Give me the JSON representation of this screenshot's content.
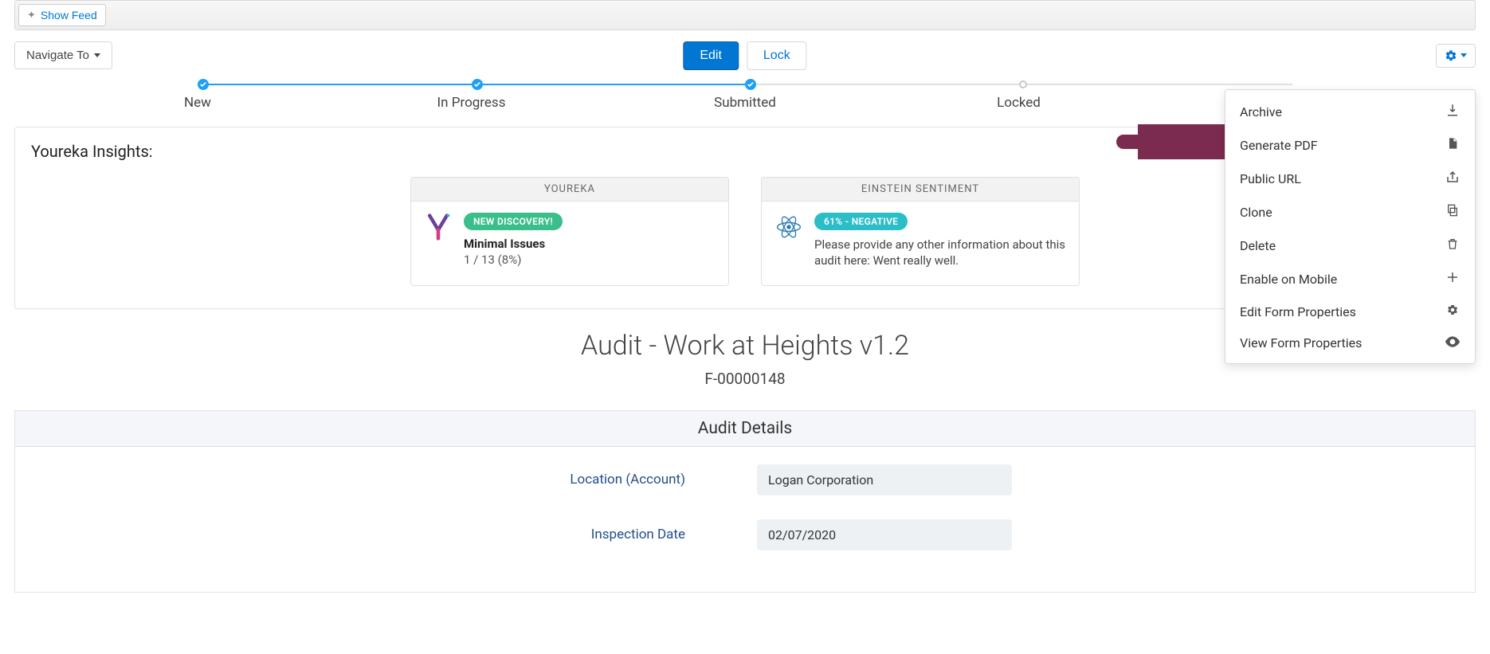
{
  "toolbar": {
    "show_feed": "Show Feed",
    "navigate_to": "Navigate To",
    "edit": "Edit",
    "lock": "Lock"
  },
  "stages": [
    "New",
    "In Progress",
    "Submitted",
    "Locked"
  ],
  "insights": {
    "title": "Youreka Insights:",
    "youreka": {
      "header": "YOUREKA",
      "badge": "NEW DISCOVERY!",
      "line1": "Minimal Issues",
      "line2": "1 / 13 (8%)"
    },
    "einstein": {
      "header": "EINSTEIN SENTIMENT",
      "badge": "61% - NEGATIVE",
      "desc": "Please provide any other information about this audit here: Went really well."
    }
  },
  "page": {
    "title": "Audit - Work at Heights v1.2",
    "subtitle": "F-00000148"
  },
  "details": {
    "header": "Audit Details",
    "fields": {
      "location_label": "Location (Account)",
      "location_value": "Logan Corporation",
      "date_label": "Inspection Date",
      "date_value": "02/07/2020"
    }
  },
  "menu": {
    "archive": "Archive",
    "generate_pdf": "Generate PDF",
    "public_url": "Public URL",
    "clone": "Clone",
    "delete": "Delete",
    "enable_mobile": "Enable on Mobile",
    "edit_form_props": "Edit Form Properties",
    "view_form_props": "View Form Properties"
  }
}
